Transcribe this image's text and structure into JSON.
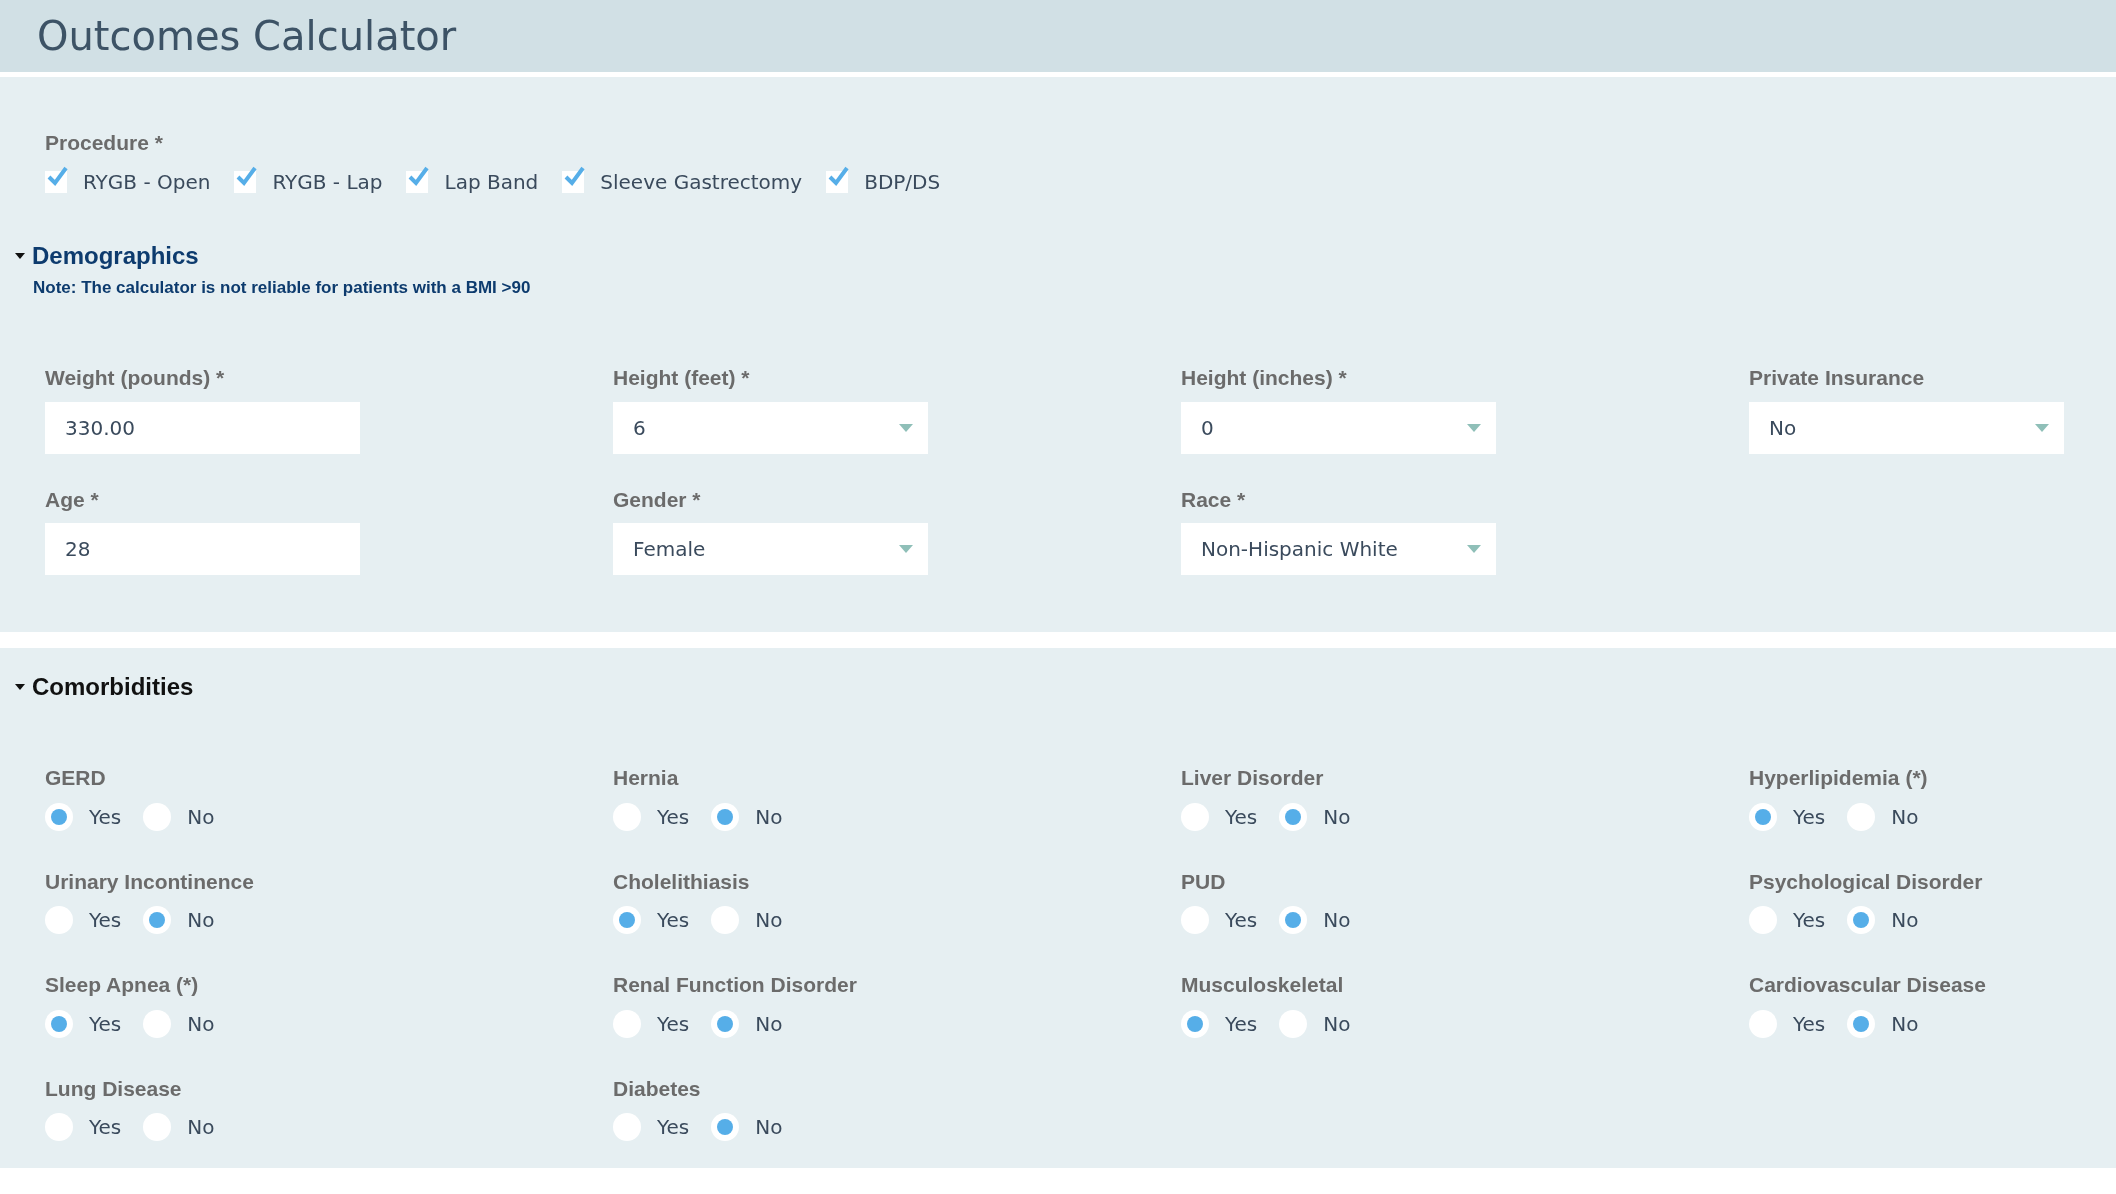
{
  "title": "Outcomes Calculator",
  "procedure": {
    "label": "Procedure *",
    "options": [
      {
        "label": "RYGB - Open",
        "checked": true
      },
      {
        "label": "RYGB - Lap",
        "checked": true
      },
      {
        "label": "Lap Band",
        "checked": true
      },
      {
        "label": "Sleeve Gastrectomy",
        "checked": true
      },
      {
        "label": "BDP/DS",
        "checked": true
      }
    ]
  },
  "demographics": {
    "heading": "Demographics",
    "expanded": true,
    "note": "Note: The calculator is not reliable for patients with a BMI >90",
    "fields": [
      {
        "label": "Weight (pounds) *",
        "kind": "text",
        "value": "330.00"
      },
      {
        "label": "Height (feet) *",
        "kind": "select",
        "value": "6"
      },
      {
        "label": "Height (inches) *",
        "kind": "select",
        "value": "0"
      },
      {
        "label": "Private Insurance",
        "kind": "select",
        "value": "No"
      },
      {
        "label": "Age *",
        "kind": "text",
        "value": "28"
      },
      {
        "label": "Gender *",
        "kind": "select",
        "value": "Female"
      },
      {
        "label": "Race *",
        "kind": "select",
        "value": "Non-Hispanic White"
      }
    ]
  },
  "comorbidities": {
    "heading": "Comorbidities",
    "expanded": true,
    "items": [
      {
        "label": "GERD",
        "options": [
          {
            "label": "Yes",
            "selected": true
          },
          {
            "label": "No",
            "selected": false
          }
        ]
      },
      {
        "label": "Hernia",
        "options": [
          {
            "label": "Yes",
            "selected": false
          },
          {
            "label": "No",
            "selected": true
          }
        ]
      },
      {
        "label": "Liver Disorder",
        "options": [
          {
            "label": "Yes",
            "selected": false
          },
          {
            "label": "No",
            "selected": true
          }
        ]
      },
      {
        "label": "Hyperlipidemia (*)",
        "options": [
          {
            "label": "Yes",
            "selected": true
          },
          {
            "label": "No",
            "selected": false
          }
        ]
      },
      {
        "label": "Urinary Incontinence",
        "options": [
          {
            "label": "Yes",
            "selected": false
          },
          {
            "label": "No",
            "selected": true
          }
        ]
      },
      {
        "label": "Cholelithiasis",
        "options": [
          {
            "label": "Yes",
            "selected": true
          },
          {
            "label": "No",
            "selected": false
          }
        ]
      },
      {
        "label": "PUD",
        "options": [
          {
            "label": "Yes",
            "selected": false
          },
          {
            "label": "No",
            "selected": true
          }
        ]
      },
      {
        "label": "Psychological Disorder",
        "options": [
          {
            "label": "Yes",
            "selected": false
          },
          {
            "label": "No",
            "selected": true
          }
        ]
      },
      {
        "label": "Sleep Apnea (*)",
        "options": [
          {
            "label": "Yes",
            "selected": true
          },
          {
            "label": "No",
            "selected": false
          }
        ]
      },
      {
        "label": "Renal Function Disorder",
        "options": [
          {
            "label": "Yes",
            "selected": false
          },
          {
            "label": "No",
            "selected": true
          }
        ]
      },
      {
        "label": "Musculoskeletal",
        "options": [
          {
            "label": "Yes",
            "selected": true
          },
          {
            "label": "No",
            "selected": false
          }
        ]
      },
      {
        "label": "Cardiovascular Disease",
        "options": [
          {
            "label": "Yes",
            "selected": false
          },
          {
            "label": "No",
            "selected": true
          }
        ]
      },
      {
        "label": "Lung Disease",
        "options": [
          {
            "label": "Yes",
            "selected": false
          },
          {
            "label": "No",
            "selected": false
          }
        ]
      },
      {
        "label": "Diabetes",
        "options": [
          {
            "label": "Yes",
            "selected": false
          },
          {
            "label": "No",
            "selected": true
          }
        ]
      }
    ]
  }
}
